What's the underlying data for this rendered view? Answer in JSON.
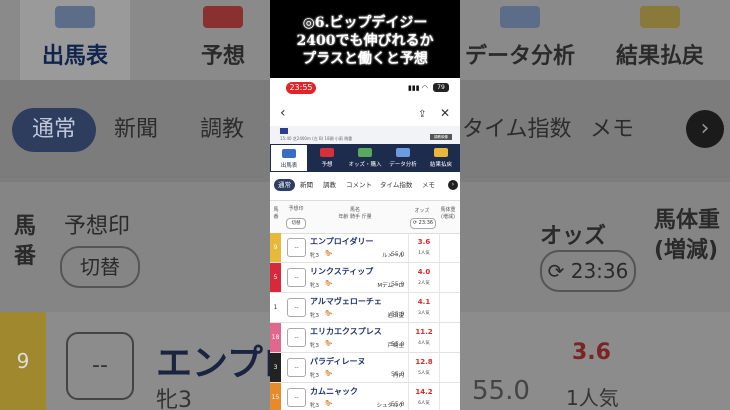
{
  "overlay_title": {
    "line1": "◎6.ビップデイジー",
    "line2": "2400でも伸びれるか",
    "line3": "プラスと働くと予想"
  },
  "background": {
    "categories": [
      "出馬表",
      "予想",
      "オッズ・購入",
      "データ分析",
      "結果払戻"
    ],
    "visible_categories": {
      "c0": "出馬表",
      "c1": "予想",
      "c3": "データ分析",
      "c4": "結果払戻"
    },
    "tabs": {
      "t0": "通常",
      "t1": "新聞",
      "t2": "調教",
      "t3": "タイム指数",
      "t4": "メモ"
    },
    "headers": {
      "umaban_1": "馬",
      "umaban_2": "番",
      "mark": "予想印",
      "switch": "切替",
      "odds": "オッズ",
      "odds_time": "23:36",
      "weight_1": "馬体重",
      "weight_2": "(増減)"
    },
    "row": {
      "number": "9",
      "mark": "--",
      "name": "エンプロ",
      "sex_age": "牝3",
      "weight": "55.0",
      "odds": "3.6",
      "popularity": "1人気"
    }
  },
  "phone": {
    "status": {
      "time": "23:55",
      "battery": "79"
    },
    "race_info": "15:40 芝2400m (左 B) 18頭 小雨 稍重",
    "race_button": "調教映像",
    "categories": {
      "c0": "出馬表",
      "c1": "予想",
      "c2": "オッズ・購入",
      "c3": "データ分析",
      "c4": "結果払戻"
    },
    "tabs": {
      "t0": "通常",
      "t1": "新聞",
      "t2": "調教",
      "t3": "コメント",
      "t4": "タイム指数",
      "t5": "メモ"
    },
    "headers": {
      "umaban_1": "馬",
      "umaban_2": "番",
      "mark": "予想印",
      "switch": "切替",
      "name_1": "馬名",
      "name_2": "年齢 騎手 斤量",
      "odds": "オッズ",
      "odds_time": "23:36",
      "weight_1": "馬体重",
      "weight_2": "(増減)"
    },
    "rows": [
      {
        "num": "9",
        "color": "#e8b83a",
        "text": "#fff",
        "mark": "--",
        "name": "エンプロイダリー",
        "sex": "牝3",
        "jockey": "ルメール",
        "weight": "55.0",
        "odds": "3.6",
        "pop": "1人気"
      },
      {
        "num": "5",
        "color": "#d8283c",
        "text": "#fff",
        "mark": "--",
        "name": "リンクスティップ",
        "sex": "牝3",
        "jockey": "Mデムーロ",
        "weight": "55.0",
        "odds": "4.0",
        "pop": "2人気"
      },
      {
        "num": "1",
        "color": "#ffffff",
        "text": "#333",
        "mark": "--",
        "name": "アルマヴェローチェ",
        "sex": "牝3",
        "jockey": "岩田望",
        "weight": "55.0",
        "odds": "4.1",
        "pop": "3人気"
      },
      {
        "num": "18",
        "color": "#e0688c",
        "text": "#fff",
        "mark": "--",
        "name": "エリカエクスプレス",
        "sex": "牝3",
        "jockey": "戸崎圭",
        "weight": "55.0",
        "odds": "11.2",
        "pop": "4人気"
      },
      {
        "num": "3",
        "color": "#222222",
        "text": "#fff",
        "mark": "--",
        "name": "パラディレーヌ",
        "sex": "牝3",
        "jockey": "丹内",
        "weight": "55.0",
        "odds": "12.8",
        "pop": "5人気"
      },
      {
        "num": "15",
        "color": "#e88a2a",
        "text": "#fff",
        "mark": "--",
        "name": "カムニャック",
        "sex": "牝3",
        "jockey": "シュタルケ",
        "weight": "55.0",
        "odds": "14.2",
        "pop": "6人気"
      }
    ]
  }
}
